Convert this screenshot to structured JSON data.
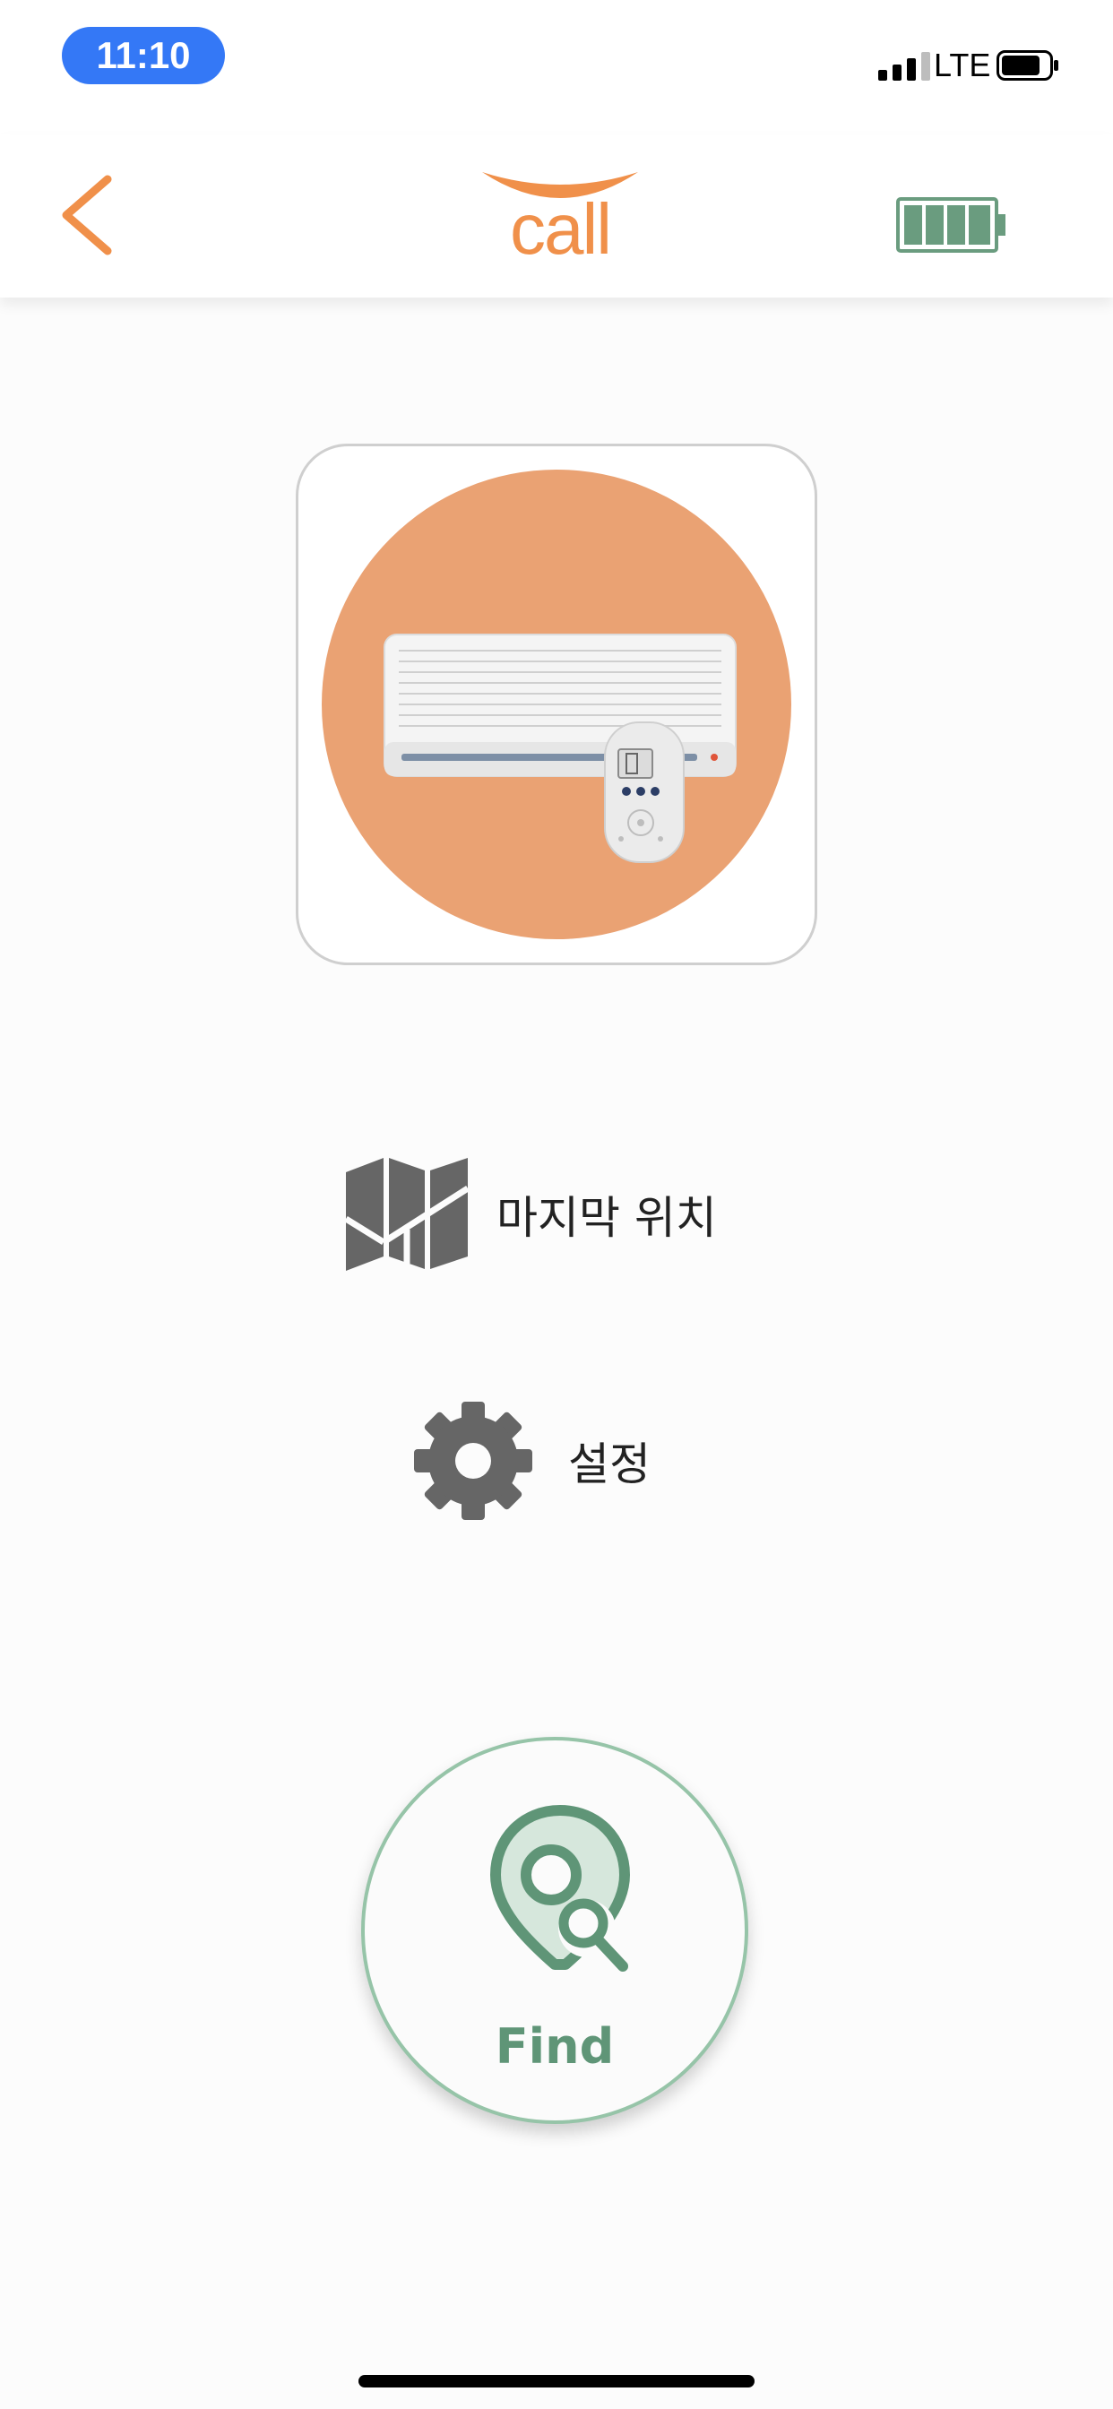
{
  "status_bar": {
    "time": "11:10",
    "network": "LTE",
    "signal_bars_active": 3,
    "signal_bars_total": 4,
    "phone_battery_level": 0.8
  },
  "header": {
    "back_icon": "chevron-left-icon",
    "logo_text": "call",
    "device_battery_icon": "battery-full-icon",
    "device_battery_level": 1.0,
    "accent_color": "#f0904a",
    "device_color": "#6a9c7f"
  },
  "product": {
    "image_icon": "air-conditioner-with-remote-icon",
    "circle_color": "#eaa273"
  },
  "menu": {
    "last_location": {
      "label": "마지막 위치",
      "icon": "map-icon"
    },
    "settings": {
      "label": "설정",
      "icon": "gear-icon"
    }
  },
  "find_button": {
    "label": "Find",
    "icon": "location-search-icon",
    "color": "#5f9577",
    "border_color": "#96c4a8"
  }
}
